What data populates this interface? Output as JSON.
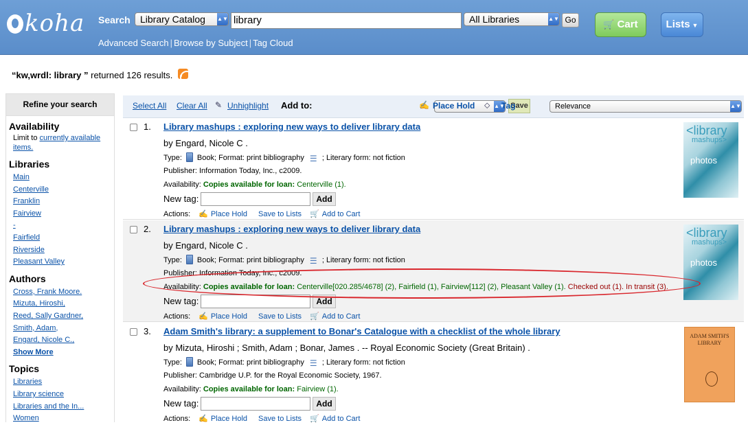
{
  "header": {
    "logo_text": "koha",
    "search_label": "Search",
    "catalog_select": "Library Catalog",
    "query": "library",
    "libraries_select": "All Libraries",
    "go_label": "Go",
    "cart_label": "Cart",
    "lists_label": "Lists",
    "links": [
      "Advanced Search",
      "Browse by Subject",
      "Tag Cloud"
    ]
  },
  "summary": {
    "query_text": "“kw,wrdl: library ”",
    "result_text": "returned 126 results."
  },
  "sidebar": {
    "title": "Refine your search",
    "availability_heading": "Availability",
    "limit_prefix": "Limit to ",
    "limit_link": "currently available items.",
    "libraries_heading": "Libraries",
    "libraries": [
      "Main",
      "Centerville",
      "Franklin",
      "Fairview",
      "-",
      "Fairfield",
      "Riverside",
      "Pleasant Valley"
    ],
    "authors_heading": "Authors",
    "authors": [
      "Cross, Frank Moore.",
      "Mizuta, Hiroshi,",
      "Reed, Sally Gardner,",
      "Smith, Adam,",
      "Engard, Nicole C.,"
    ],
    "show_more": "Show More",
    "topics_heading": "Topics",
    "topics": [
      "Libraries",
      "Library science",
      "Libraries and the In...",
      "Women"
    ]
  },
  "toolbar": {
    "select_all": "Select All",
    "clear_all": "Clear All",
    "unhighlight": "Unhighlight",
    "add_to": "Add to:",
    "save": "Save",
    "place_hold": "Place Hold",
    "tag": "Tag",
    "sort": "Relevance"
  },
  "results": [
    {
      "num": "1.",
      "title": "Library mashups : exploring new ways to deliver library data",
      "author": "by Engard, Nicole C .",
      "type_label": "Type:",
      "type_value": "Book; Format: print bibliography",
      "literary": "; Literary form: not fiction",
      "publisher": "Publisher: Information Today, Inc., c2009.",
      "availability_label": "Availability:",
      "availability_green": "Copies available for loan:",
      "availability_loc": "Centerville (1).",
      "availability_red": "",
      "newtag": "New tag:",
      "add": "Add",
      "actions_label": "Actions:",
      "action_hold": "Place Hold",
      "action_lists": "Save to Lists",
      "action_cart": "Add to Cart",
      "cover_title": "<library",
      "cover_sub": "mashups>",
      "cover_word": "photos"
    },
    {
      "num": "2.",
      "title": "Library mashups : exploring new ways to deliver library data",
      "author": "by Engard, Nicole C .",
      "type_label": "Type:",
      "type_value": "Book; Format: print bibliography",
      "literary": "; Literary form: not fiction",
      "publisher": "Publisher: Information Today, Inc., c2009.",
      "availability_label": "Availability:",
      "availability_green": "Copies available for loan:",
      "availability_loc": "Centerville[020.285/4678] (2), Fairfield (1), Fairview[112] (2), Pleasant Valley (1).",
      "availability_red": "Checked out (1). In transit (3).",
      "newtag": "New tag:",
      "add": "Add",
      "actions_label": "Actions:",
      "action_hold": "Place Hold",
      "action_lists": "Save to Lists",
      "action_cart": "Add to Cart",
      "cover_title": "<library",
      "cover_sub": "mashups>",
      "cover_word": "photos"
    },
    {
      "num": "3.",
      "title": "Adam Smith's library: a supplement to Bonar's Catalogue with a checklist of the whole library",
      "author": "by Mizuta, Hiroshi ; Smith, Adam ; Bonar, James . -- Royal Economic Society (Great Britain) .",
      "type_label": "Type:",
      "type_value": "Book; Format: print bibliography",
      "literary": "; Literary form: not fiction",
      "publisher": "Publisher: Cambridge U.P. for the Royal Economic Society, 1967.",
      "availability_label": "Availability:",
      "availability_green": "Copies available for loan:",
      "availability_loc": "Fairview (1).",
      "availability_red": "",
      "newtag": "New tag:",
      "add": "Add",
      "actions_label": "Actions:",
      "action_hold": "Place Hold",
      "action_lists": "Save to Lists",
      "action_cart": "Add to Cart",
      "cover_title": "ADAM SMITH'S LIBRARY"
    }
  ]
}
